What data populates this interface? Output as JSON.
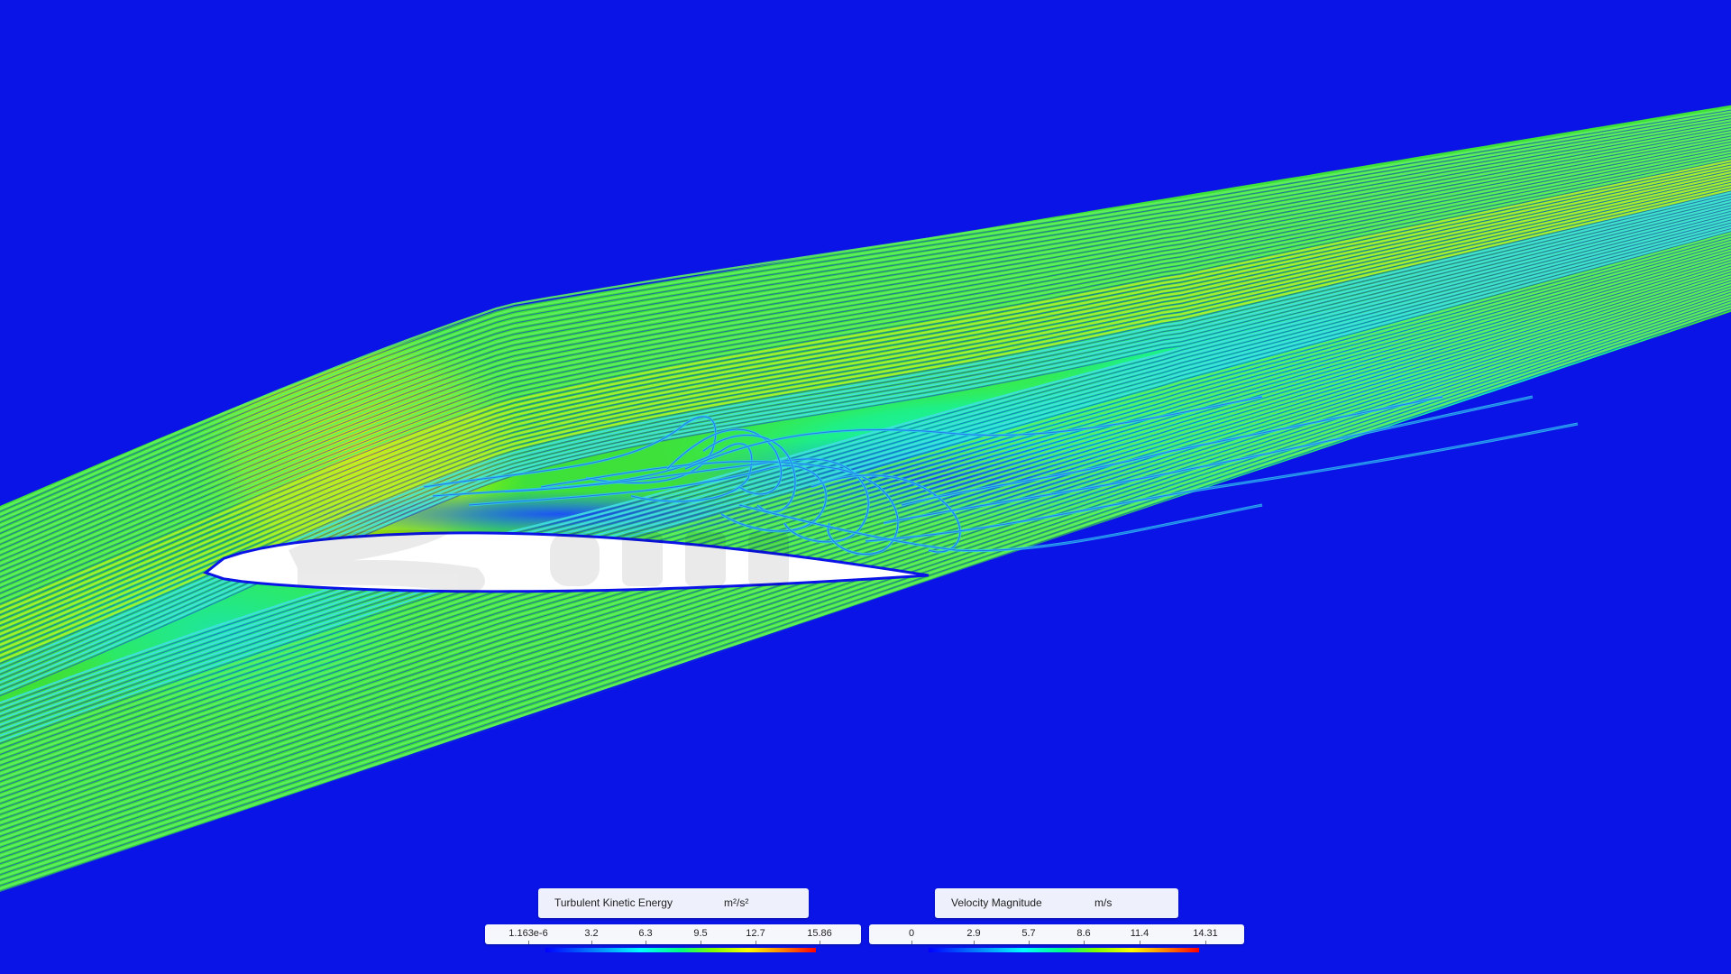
{
  "scene": {
    "background_color": "#0a14e6",
    "airfoil_color": "#ffffff",
    "colormap": [
      "#0000ff",
      "#0080ff",
      "#00ffff",
      "#00ff80",
      "#80ff00",
      "#ffff00",
      "#ff8000",
      "#ff0000"
    ]
  },
  "legends": [
    {
      "title": "Turbulent Kinetic Energy",
      "unit": "m²/s²",
      "ticks": [
        "1.163e-6",
        "3.2",
        "6.3",
        "9.5",
        "12.7",
        "15.86"
      ]
    },
    {
      "title": "Velocity Magnitude",
      "unit": "m/s",
      "ticks": [
        "0",
        "2.9",
        "5.7",
        "8.6",
        "11.4",
        "14.31"
      ]
    }
  ]
}
